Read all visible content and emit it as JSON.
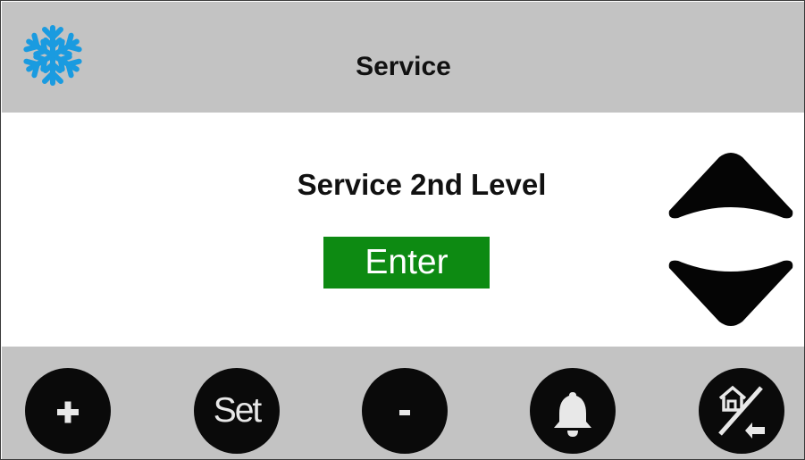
{
  "header": {
    "icon": "snowflake-icon",
    "icon_color": "#1a9be0",
    "title": "Service"
  },
  "main": {
    "subtitle": "Service 2nd Level",
    "enter_label": "Enter",
    "enter_color": "#0d8a12",
    "up_icon": "arrow-up-icon",
    "down_icon": "arrow-down-icon"
  },
  "footer": {
    "buttons": [
      {
        "name": "plus-button",
        "icon": "plus-icon"
      },
      {
        "name": "set-button",
        "label": "Set"
      },
      {
        "name": "minus-button",
        "icon": "minus-icon"
      },
      {
        "name": "alarm-button",
        "icon": "bell-icon"
      },
      {
        "name": "home-back-button",
        "icon": "home-back-icon"
      }
    ]
  },
  "colors": {
    "bar_gray": "#c3c3c3",
    "button_black": "#0a0a0a"
  }
}
